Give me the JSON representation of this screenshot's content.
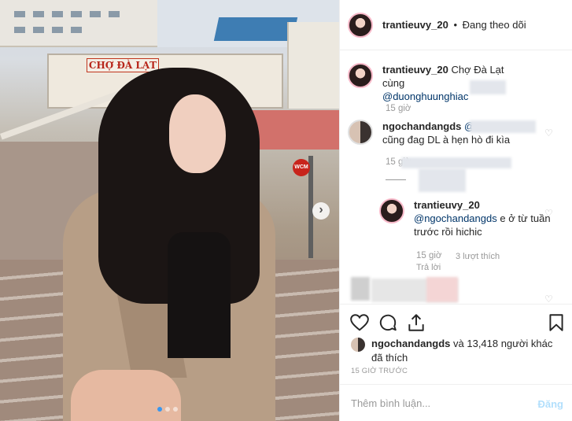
{
  "photo": {
    "market_sign": "CHỢ ĐÀ LẠT",
    "slide_count": 3,
    "active_slide": 1
  },
  "header": {
    "username": "trantieuvy_20",
    "separator": "•",
    "follow_label": "Đang theo dõi"
  },
  "caption": {
    "username": "trantieuvy_20",
    "text": "Chợ Đà Lạt cùng",
    "mention": "@duonghuunghiac",
    "time": "15 giờ"
  },
  "comments": [
    {
      "username": "ngochandangds",
      "mention": "@",
      "text": "cũng đag DL à hẹn hò đi kìa",
      "time": "15 giờ"
    }
  ],
  "reply": {
    "username": "trantieuvy_20",
    "mention": "@ngochandangds",
    "text": "e ở từ tuần trước rồi hichic",
    "time": "15 giờ",
    "likes": "3 lượt thích",
    "reply_label": "Trả lời"
  },
  "likes_line": {
    "user": "ngochandangds",
    "text": "và 13,418 người khác đã thích"
  },
  "timestamp": "15 GIỜ TRƯỚC",
  "add_comment": {
    "placeholder": "Thêm bình luận...",
    "post_label": "Đăng"
  },
  "colors": {
    "link": "#003569",
    "post_disabled": "#b2dffc",
    "slide_active": "#3897f0"
  },
  "icons": [
    "next-arrow-icon",
    "heart-icon",
    "comment-icon",
    "share-icon",
    "bookmark-icon"
  ]
}
